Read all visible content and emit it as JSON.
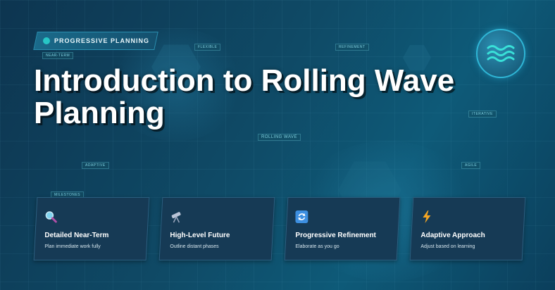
{
  "badge": {
    "label": "PROGRESSIVE PLANNING",
    "dot_color": "#27c6c6"
  },
  "title": {
    "line1": "Introduction to Rolling Wave",
    "line2": "Planning"
  },
  "logo": {
    "icon": "wave-icon"
  },
  "background_tags": [
    "Near-term",
    "Flexible",
    "Refinement",
    "Rolling wave",
    "Iterative",
    "Adaptive",
    "Milestones",
    "Agile"
  ],
  "cards": [
    {
      "icon": "magnifier-icon",
      "title": "Detailed Near-Term",
      "description": "Plan immediate work fully"
    },
    {
      "icon": "telescope-icon",
      "title": "High-Level Future",
      "description": "Outline distant phases"
    },
    {
      "icon": "refresh-icon",
      "title": "Progressive Refinement",
      "description": "Elaborate as you go"
    },
    {
      "icon": "lightning-icon",
      "title": "Adaptive Approach",
      "description": "Adjust based on learning"
    }
  ],
  "colors": {
    "accent": "#27c6c6",
    "card_bg": "#163a55",
    "background": "#0f4a66"
  }
}
